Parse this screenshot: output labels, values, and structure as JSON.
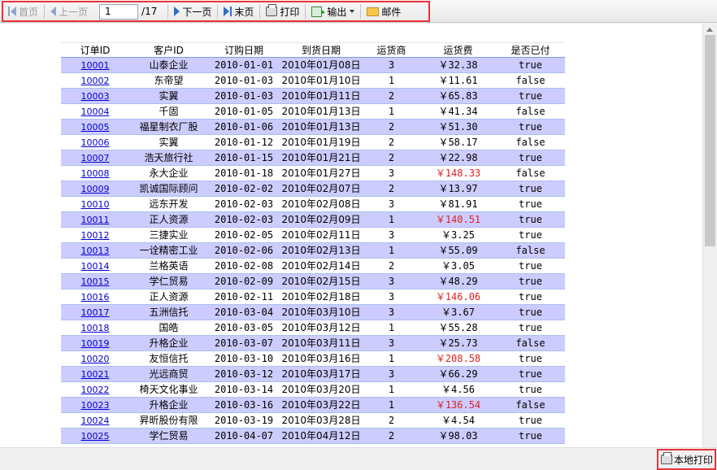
{
  "toolbar": {
    "first_label": "首页",
    "prev_label": "上一页",
    "page_value": "1",
    "page_total": "/17",
    "next_label": "下一页",
    "last_label": "末页",
    "print_label": "打印",
    "export_label": "输出",
    "mail_label": "邮件"
  },
  "table": {
    "headers": [
      "订单ID",
      "客户ID",
      "订购日期",
      "到货日期",
      "运货商",
      "运货费",
      "是否已付"
    ],
    "rows": [
      {
        "id": "10001",
        "customer": "山泰企业",
        "order_date": "2010-01-01",
        "arrive": "2010年01月08日",
        "shipper": "3",
        "fee": "￥32.38",
        "paid": "true",
        "red": false
      },
      {
        "id": "10002",
        "customer": "东帝望",
        "order_date": "2010-01-03",
        "arrive": "2010年01月10日",
        "shipper": "1",
        "fee": "￥11.61",
        "paid": "false",
        "red": false
      },
      {
        "id": "10003",
        "customer": "实翼",
        "order_date": "2010-01-03",
        "arrive": "2010年01月11日",
        "shipper": "2",
        "fee": "￥65.83",
        "paid": "true",
        "red": false
      },
      {
        "id": "10004",
        "customer": "千固",
        "order_date": "2010-01-05",
        "arrive": "2010年01月13日",
        "shipper": "1",
        "fee": "￥41.34",
        "paid": "false",
        "red": false
      },
      {
        "id": "10005",
        "customer": "福星制衣厂股",
        "order_date": "2010-01-06",
        "arrive": "2010年01月13日",
        "shipper": "2",
        "fee": "￥51.30",
        "paid": "true",
        "red": false
      },
      {
        "id": "10006",
        "customer": "实翼",
        "order_date": "2010-01-12",
        "arrive": "2010年01月19日",
        "shipper": "2",
        "fee": "￥58.17",
        "paid": "false",
        "red": false
      },
      {
        "id": "10007",
        "customer": "浩天旅行社",
        "order_date": "2010-01-15",
        "arrive": "2010年01月21日",
        "shipper": "2",
        "fee": "￥22.98",
        "paid": "true",
        "red": false
      },
      {
        "id": "10008",
        "customer": "永大企业",
        "order_date": "2010-01-18",
        "arrive": "2010年01月27日",
        "shipper": "3",
        "fee": "￥148.33",
        "paid": "false",
        "red": true
      },
      {
        "id": "10009",
        "customer": "凯诚国际顾问",
        "order_date": "2010-02-02",
        "arrive": "2010年02月07日",
        "shipper": "2",
        "fee": "￥13.97",
        "paid": "true",
        "red": false
      },
      {
        "id": "10010",
        "customer": "远东开发",
        "order_date": "2010-02-03",
        "arrive": "2010年02月08日",
        "shipper": "3",
        "fee": "￥81.91",
        "paid": "true",
        "red": false
      },
      {
        "id": "10011",
        "customer": "正人资源",
        "order_date": "2010-02-03",
        "arrive": "2010年02月09日",
        "shipper": "1",
        "fee": "￥140.51",
        "paid": "true",
        "red": true
      },
      {
        "id": "10012",
        "customer": "三捷实业",
        "order_date": "2010-02-05",
        "arrive": "2010年02月11日",
        "shipper": "3",
        "fee": "￥3.25",
        "paid": "true",
        "red": false
      },
      {
        "id": "10013",
        "customer": "一诠精密工业",
        "order_date": "2010-02-06",
        "arrive": "2010年02月13日",
        "shipper": "1",
        "fee": "￥55.09",
        "paid": "false",
        "red": false
      },
      {
        "id": "10014",
        "customer": "兰格英语",
        "order_date": "2010-02-08",
        "arrive": "2010年02月14日",
        "shipper": "2",
        "fee": "￥3.05",
        "paid": "true",
        "red": false
      },
      {
        "id": "10015",
        "customer": "学仁贸易",
        "order_date": "2010-02-09",
        "arrive": "2010年02月15日",
        "shipper": "3",
        "fee": "￥48.29",
        "paid": "true",
        "red": false
      },
      {
        "id": "10016",
        "customer": "正人资源",
        "order_date": "2010-02-11",
        "arrive": "2010年02月18日",
        "shipper": "3",
        "fee": "￥146.06",
        "paid": "true",
        "red": true
      },
      {
        "id": "10017",
        "customer": "五洲信托",
        "order_date": "2010-03-04",
        "arrive": "2010年03月10日",
        "shipper": "3",
        "fee": "￥3.67",
        "paid": "true",
        "red": false
      },
      {
        "id": "10018",
        "customer": "国皓",
        "order_date": "2010-03-05",
        "arrive": "2010年03月12日",
        "shipper": "1",
        "fee": "￥55.28",
        "paid": "true",
        "red": false
      },
      {
        "id": "10019",
        "customer": "升格企业",
        "order_date": "2010-03-07",
        "arrive": "2010年03月11日",
        "shipper": "3",
        "fee": "￥25.73",
        "paid": "false",
        "red": false
      },
      {
        "id": "10020",
        "customer": "友恒信托",
        "order_date": "2010-03-10",
        "arrive": "2010年03月16日",
        "shipper": "1",
        "fee": "￥208.58",
        "paid": "true",
        "red": true
      },
      {
        "id": "10021",
        "customer": "光远商贸",
        "order_date": "2010-03-12",
        "arrive": "2010年03月17日",
        "shipper": "3",
        "fee": "￥66.29",
        "paid": "true",
        "red": false
      },
      {
        "id": "10022",
        "customer": "椅天文化事业",
        "order_date": "2010-03-14",
        "arrive": "2010年03月20日",
        "shipper": "1",
        "fee": "￥4.56",
        "paid": "true",
        "red": false
      },
      {
        "id": "10023",
        "customer": "升格企业",
        "order_date": "2010-03-16",
        "arrive": "2010年03月22日",
        "shipper": "1",
        "fee": "￥136.54",
        "paid": "false",
        "red": true
      },
      {
        "id": "10024",
        "customer": "昇昕股份有限",
        "order_date": "2010-03-19",
        "arrive": "2010年03月28日",
        "shipper": "2",
        "fee": "￥4.54",
        "paid": "true",
        "red": false
      },
      {
        "id": "10025",
        "customer": "学仁贸易",
        "order_date": "2010-04-07",
        "arrive": "2010年04月12日",
        "shipper": "2",
        "fee": "￥98.03",
        "paid": "true",
        "red": false
      }
    ]
  },
  "bottom": {
    "local_print_label": "本地打印"
  }
}
